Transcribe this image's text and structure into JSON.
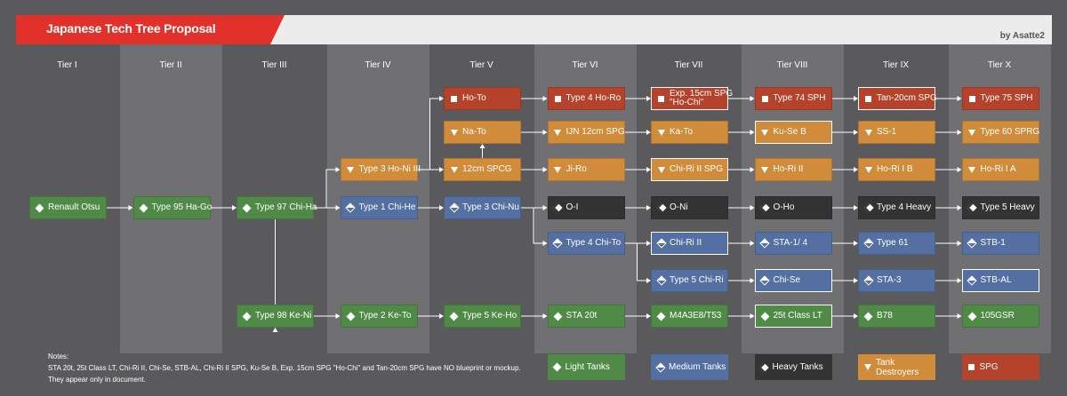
{
  "header": {
    "title": "Japanese Tech Tree Proposal",
    "author": "by Asatte2"
  },
  "tiers": [
    "Tier I",
    "Tier II",
    "Tier III",
    "Tier IV",
    "Tier V",
    "Tier VI",
    "Tier VII",
    "Tier VIII",
    "Tier IX",
    "Tier X"
  ],
  "nodes": [
    {
      "name": "Renault Otsu",
      "tier": 1,
      "row": 3,
      "class": "light"
    },
    {
      "name": "Type 95 Ha-Go",
      "tier": 2,
      "row": 3,
      "class": "light"
    },
    {
      "name": "Type 97 Chi-Ha",
      "tier": 3,
      "row": 3,
      "class": "light"
    },
    {
      "name": "Type 98 Ke-Ni",
      "tier": 3,
      "row": 6,
      "class": "light"
    },
    {
      "name": "Type 3 Ho-Ni III",
      "tier": 4,
      "row": 2,
      "class": "td"
    },
    {
      "name": "Type 1 Chi-He",
      "tier": 4,
      "row": 3,
      "class": "medium"
    },
    {
      "name": "Type 2 Ke-To",
      "tier": 4,
      "row": 6,
      "class": "light"
    },
    {
      "name": "Ho-To",
      "tier": 5,
      "row": 0,
      "class": "spg"
    },
    {
      "name": "Na-To",
      "tier": 5,
      "row": 1,
      "class": "td"
    },
    {
      "name": "12cm SPCG",
      "tier": 5,
      "row": 2,
      "class": "td"
    },
    {
      "name": "Type 3 Chi-Nu",
      "tier": 5,
      "row": 3,
      "class": "medium"
    },
    {
      "name": "Type 5 Ke-Ho",
      "tier": 5,
      "row": 6,
      "class": "light"
    },
    {
      "name": "Type 4 Ho-Ro",
      "tier": 6,
      "row": 0,
      "class": "spg"
    },
    {
      "name": "IJN 12cm SPG",
      "tier": 6,
      "row": 1,
      "class": "td"
    },
    {
      "name": "Ji-Ro",
      "tier": 6,
      "row": 2,
      "class": "td"
    },
    {
      "name": "O-I",
      "tier": 6,
      "row": 3,
      "class": "heavy"
    },
    {
      "name": "Type 4 Chi-To",
      "tier": 6,
      "row": 4,
      "class": "medium"
    },
    {
      "name": "STA 20t",
      "tier": 6,
      "row": 6,
      "class": "light"
    },
    {
      "name": "Exp. 15cm SPG\n\"Ho-Chi\"",
      "tier": 7,
      "row": 0,
      "class": "spg",
      "outlined": true
    },
    {
      "name": "Ka-To",
      "tier": 7,
      "row": 1,
      "class": "td"
    },
    {
      "name": "Chi-Ri II SPG",
      "tier": 7,
      "row": 2,
      "class": "td",
      "outlined": true
    },
    {
      "name": "O-Ni",
      "tier": 7,
      "row": 3,
      "class": "heavy"
    },
    {
      "name": "Chi-Ri II",
      "tier": 7,
      "row": 4,
      "class": "medium",
      "outlined": true
    },
    {
      "name": "Type 5 Chi-Ri",
      "tier": 7,
      "row": 5,
      "class": "medium"
    },
    {
      "name": "M4A3E8/T53",
      "tier": 7,
      "row": 6,
      "class": "light"
    },
    {
      "name": "Type 74 SPH",
      "tier": 8,
      "row": 0,
      "class": "spg"
    },
    {
      "name": "Ku-Se B",
      "tier": 8,
      "row": 1,
      "class": "td",
      "outlined": true
    },
    {
      "name": "Ho-Ri II",
      "tier": 8,
      "row": 2,
      "class": "td"
    },
    {
      "name": "O-Ho",
      "tier": 8,
      "row": 3,
      "class": "heavy"
    },
    {
      "name": "STA-1/ 4",
      "tier": 8,
      "row": 4,
      "class": "medium"
    },
    {
      "name": "Chi-Se",
      "tier": 8,
      "row": 5,
      "class": "medium",
      "outlined": true
    },
    {
      "name": "25t Class LT",
      "tier": 8,
      "row": 6,
      "class": "light",
      "outlined": true
    },
    {
      "name": "Tan-20cm SPG",
      "tier": 9,
      "row": 0,
      "class": "spg",
      "outlined": true
    },
    {
      "name": "SS-1",
      "tier": 9,
      "row": 1,
      "class": "td"
    },
    {
      "name": "Ho-Ri I B",
      "tier": 9,
      "row": 2,
      "class": "td"
    },
    {
      "name": "Type 4 Heavy",
      "tier": 9,
      "row": 3,
      "class": "heavy"
    },
    {
      "name": "Type 61",
      "tier": 9,
      "row": 4,
      "class": "medium"
    },
    {
      "name": "STA-3",
      "tier": 9,
      "row": 5,
      "class": "medium"
    },
    {
      "name": "B78",
      "tier": 9,
      "row": 6,
      "class": "light"
    },
    {
      "name": "Type 75 SPH",
      "tier": 10,
      "row": 0,
      "class": "spg"
    },
    {
      "name": "Type 60 SPRG",
      "tier": 10,
      "row": 1,
      "class": "td"
    },
    {
      "name": "Ho-Ri I A",
      "tier": 10,
      "row": 2,
      "class": "td"
    },
    {
      "name": "Type 5 Heavy",
      "tier": 10,
      "row": 3,
      "class": "heavy"
    },
    {
      "name": "STB-1",
      "tier": 10,
      "row": 4,
      "class": "medium"
    },
    {
      "name": "STB-AL",
      "tier": 10,
      "row": 5,
      "class": "medium",
      "outlined": true
    },
    {
      "name": "105GSR",
      "tier": 10,
      "row": 6,
      "class": "light"
    }
  ],
  "edges": [
    [
      "Renault Otsu",
      "Type 95 Ha-Go"
    ],
    [
      "Type 95 Ha-Go",
      "Type 97 Chi-Ha"
    ],
    [
      "Type 97 Chi-Ha",
      "Type 3 Ho-Ni III"
    ],
    [
      "Type 97 Chi-Ha",
      "Type 1 Chi-He"
    ],
    [
      "Type 97 Chi-Ha",
      "Type 98 Ke-Ni"
    ],
    [
      "Type 98 Ke-Ni",
      "Type 2 Ke-To"
    ],
    [
      "Type 2 Ke-To",
      "Type 5 Ke-Ho"
    ],
    [
      "Type 3 Ho-Ni III",
      "Ho-To"
    ],
    [
      "Type 3 Ho-Ni III",
      "12cm SPCG"
    ],
    [
      "12cm SPCG",
      "Na-To"
    ],
    [
      "Type 1 Chi-He",
      "Type 3 Chi-Nu"
    ],
    [
      "Ho-To",
      "Type 4 Ho-Ro"
    ],
    [
      "Na-To",
      "IJN 12cm SPG"
    ],
    [
      "12cm SPCG",
      "Ji-Ro"
    ],
    [
      "Type 3 Chi-Nu",
      "O-I"
    ],
    [
      "Type 3 Chi-Nu",
      "Type 4 Chi-To"
    ],
    [
      "Type 5 Ke-Ho",
      "STA 20t"
    ],
    [
      "Type 4 Ho-Ro",
      "Exp. 15cm SPG\n\"Ho-Chi\""
    ],
    [
      "IJN 12cm SPG",
      "Ka-To"
    ],
    [
      "Ji-Ro",
      "Chi-Ri II SPG"
    ],
    [
      "O-I",
      "O-Ni"
    ],
    [
      "Type 4 Chi-To",
      "Chi-Ri II"
    ],
    [
      "Type 4 Chi-To",
      "Type 5 Chi-Ri"
    ],
    [
      "STA 20t",
      "M4A3E8/T53"
    ],
    [
      "Exp. 15cm SPG\n\"Ho-Chi\"",
      "Type 74 SPH"
    ],
    [
      "Ka-To",
      "Ku-Se B"
    ],
    [
      "Chi-Ri II SPG",
      "Ho-Ri II"
    ],
    [
      "O-Ni",
      "O-Ho"
    ],
    [
      "Chi-Ri II",
      "STA-1/ 4"
    ],
    [
      "Type 5 Chi-Ri",
      "Chi-Se"
    ],
    [
      "M4A3E8/T53",
      "25t Class LT"
    ],
    [
      "Type 74 SPH",
      "Tan-20cm SPG"
    ],
    [
      "Ku-Se B",
      "SS-1"
    ],
    [
      "Ho-Ri II",
      "Ho-Ri I B"
    ],
    [
      "O-Ho",
      "Type 4 Heavy"
    ],
    [
      "STA-1/ 4",
      "Type 61"
    ],
    [
      "Chi-Se",
      "STA-3"
    ],
    [
      "25t Class LT",
      "B78"
    ],
    [
      "Tan-20cm SPG",
      "Type 75 SPH"
    ],
    [
      "SS-1",
      "Type 60 SPRG"
    ],
    [
      "Ho-Ri I B",
      "Ho-Ri I A"
    ],
    [
      "Type 4 Heavy",
      "Type 5 Heavy"
    ],
    [
      "Type 61",
      "STB-1"
    ],
    [
      "STA-3",
      "STB-AL"
    ],
    [
      "B78",
      "105GSR"
    ]
  ],
  "notes": [
    "Notes:",
    "STA 20t, 25t Class LT, Chi-Ri II, Chi-Se, STB-AL, Chi-Ri II SPG, Ku-Se B, Exp. 15cm SPG \"Ho-Chi\" and Tan-20cm SPG have NO blueprint or mockup.",
    "They appear only in document."
  ],
  "legend": [
    {
      "label": "Light Tanks",
      "class": "light"
    },
    {
      "label": "Medium Tanks",
      "class": "medium"
    },
    {
      "label": "Heavy Tanks",
      "class": "heavy"
    },
    {
      "label": "Tank\nDestroyers",
      "class": "td"
    },
    {
      "label": "SPG",
      "class": "spg"
    }
  ],
  "colors": {
    "light": "#4f8a47",
    "medium": "#5470a3",
    "heavy": "#333333",
    "td": "#d08c3a",
    "spg": "#b5422a",
    "banner": "#e2312b"
  }
}
